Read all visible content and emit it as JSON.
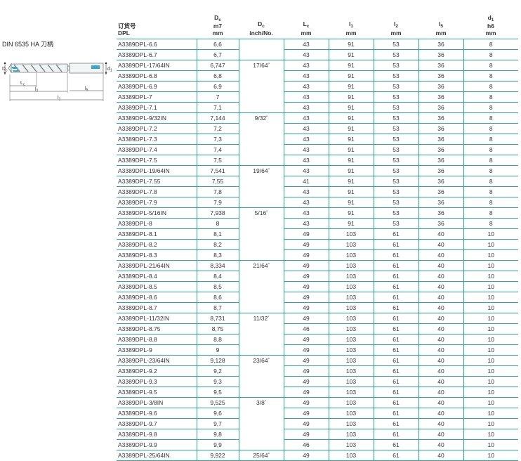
{
  "left_panel": {
    "standard_label": "DIN 6535 HA 刀柄",
    "diagram_labels": {
      "dc": "D",
      "dc_sub": "c",
      "d1": "d",
      "d1_sub": "1",
      "lc": "L",
      "lc_sub": "c",
      "l2": "l",
      "l2_sub": "2",
      "l5": "l",
      "l5_sub": "5",
      "l1": "l",
      "l1_sub": "1"
    }
  },
  "table": {
    "headers": {
      "order_line1": "订货号",
      "order_line2": "DPL",
      "dc_main": "D",
      "dc_sub": "c",
      "dc_line2": "m7",
      "dc_line3": "mm",
      "inch_main": "D",
      "inch_sub": "c",
      "inch_line2": "inch/No.",
      "lc_main": "L",
      "lc_sub": "c",
      "lc_line2": "mm",
      "l1_main": "l",
      "l1_sub": "1",
      "l1_line2": "mm",
      "l2_main": "l",
      "l2_sub": "2",
      "l2_line2": "mm",
      "l5_main": "l",
      "l5_sub": "5",
      "l5_line2": "mm",
      "d1_main": "d",
      "d1_sub": "1",
      "d1_line2": "h6",
      "d1_line3": "mm"
    },
    "rows": [
      {
        "order": "A3389DPL-6.6",
        "dc": "6,6",
        "inch": "",
        "lc": "43",
        "l1": "91",
        "l2": "53",
        "l5": "36",
        "d1": "8"
      },
      {
        "order": "A3389DPL-6.7",
        "dc": "6,7",
        "inch": "",
        "lc": "43",
        "l1": "91",
        "l2": "53",
        "l5": "36",
        "d1": "8"
      },
      {
        "order": "A3389DPL-17/64IN",
        "dc": "6,747",
        "inch": "17/64",
        "lc": "43",
        "l1": "91",
        "l2": "53",
        "l5": "36",
        "d1": "8"
      },
      {
        "order": "A3389DPL-6.8",
        "dc": "6,8",
        "inch": "",
        "lc": "43",
        "l1": "91",
        "l2": "53",
        "l5": "36",
        "d1": "8"
      },
      {
        "order": "A3389DPL-6.9",
        "dc": "6,9",
        "inch": "",
        "lc": "43",
        "l1": "91",
        "l2": "53",
        "l5": "36",
        "d1": "8"
      },
      {
        "order": "A3389DPL-7",
        "dc": "7",
        "inch": "",
        "lc": "43",
        "l1": "91",
        "l2": "53",
        "l5": "36",
        "d1": "8"
      },
      {
        "order": "A3389DPL-7.1",
        "dc": "7,1",
        "inch": "",
        "lc": "43",
        "l1": "91",
        "l2": "53",
        "l5": "36",
        "d1": "8"
      },
      {
        "order": "A3389DPL-9/32IN",
        "dc": "7,144",
        "inch": "9/32",
        "lc": "43",
        "l1": "91",
        "l2": "53",
        "l5": "36",
        "d1": "8"
      },
      {
        "order": "A3389DPL-7.2",
        "dc": "7,2",
        "inch": "",
        "lc": "43",
        "l1": "91",
        "l2": "53",
        "l5": "36",
        "d1": "8"
      },
      {
        "order": "A3389DPL-7.3",
        "dc": "7,3",
        "inch": "",
        "lc": "43",
        "l1": "91",
        "l2": "53",
        "l5": "36",
        "d1": "8"
      },
      {
        "order": "A3389DPL-7.4",
        "dc": "7,4",
        "inch": "",
        "lc": "43",
        "l1": "91",
        "l2": "53",
        "l5": "36",
        "d1": "8"
      },
      {
        "order": "A3389DPL-7.5",
        "dc": "7,5",
        "inch": "",
        "lc": "43",
        "l1": "91",
        "l2": "53",
        "l5": "36",
        "d1": "8"
      },
      {
        "order": "A3389DPL-19/64IN",
        "dc": "7,541",
        "inch": "19/64",
        "lc": "43",
        "l1": "91",
        "l2": "53",
        "l5": "36",
        "d1": "8"
      },
      {
        "order": "A3389DPL-7.55",
        "dc": "7,55",
        "inch": "",
        "lc": "41",
        "l1": "91",
        "l2": "53",
        "l5": "36",
        "d1": "8"
      },
      {
        "order": "A3389DPL-7.8",
        "dc": "7,8",
        "inch": "",
        "lc": "43",
        "l1": "91",
        "l2": "53",
        "l5": "36",
        "d1": "8"
      },
      {
        "order": "A3389DPL-7.9",
        "dc": "7,9",
        "inch": "",
        "lc": "43",
        "l1": "91",
        "l2": "53",
        "l5": "36",
        "d1": "8"
      },
      {
        "order": "A3389DPL-5/16IN",
        "dc": "7,938",
        "inch": "5/16",
        "lc": "43",
        "l1": "91",
        "l2": "53",
        "l5": "36",
        "d1": "8"
      },
      {
        "order": "A3389DPL-8",
        "dc": "8",
        "inch": "",
        "lc": "43",
        "l1": "91",
        "l2": "53",
        "l5": "36",
        "d1": "8"
      },
      {
        "order": "A3389DPL-8.1",
        "dc": "8,1",
        "inch": "",
        "lc": "49",
        "l1": "103",
        "l2": "61",
        "l5": "40",
        "d1": "10"
      },
      {
        "order": "A3389DPL-8.2",
        "dc": "8,2",
        "inch": "",
        "lc": "49",
        "l1": "103",
        "l2": "61",
        "l5": "40",
        "d1": "10"
      },
      {
        "order": "A3389DPL-8.3",
        "dc": "8,3",
        "inch": "",
        "lc": "49",
        "l1": "103",
        "l2": "61",
        "l5": "40",
        "d1": "10"
      },
      {
        "order": "A3389DPL-21/64IN",
        "dc": "8,334",
        "inch": "21/64",
        "lc": "49",
        "l1": "103",
        "l2": "61",
        "l5": "40",
        "d1": "10"
      },
      {
        "order": "A3389DPL-8.4",
        "dc": "8,4",
        "inch": "",
        "lc": "49",
        "l1": "103",
        "l2": "61",
        "l5": "40",
        "d1": "10"
      },
      {
        "order": "A3389DPL-8.5",
        "dc": "8,5",
        "inch": "",
        "lc": "49",
        "l1": "103",
        "l2": "61",
        "l5": "40",
        "d1": "10"
      },
      {
        "order": "A3389DPL-8.6",
        "dc": "8,6",
        "inch": "",
        "lc": "49",
        "l1": "103",
        "l2": "61",
        "l5": "40",
        "d1": "10"
      },
      {
        "order": "A3389DPL-8.7",
        "dc": "8,7",
        "inch": "",
        "lc": "49",
        "l1": "103",
        "l2": "61",
        "l5": "40",
        "d1": "10"
      },
      {
        "order": "A3389DPL-11/32IN",
        "dc": "8,731",
        "inch": "11/32",
        "lc": "49",
        "l1": "103",
        "l2": "61",
        "l5": "40",
        "d1": "10"
      },
      {
        "order": "A3389DPL-8.75",
        "dc": "8,75",
        "inch": "",
        "lc": "46",
        "l1": "103",
        "l2": "61",
        "l5": "40",
        "d1": "10"
      },
      {
        "order": "A3389DPL-8.8",
        "dc": "8,8",
        "inch": "",
        "lc": "49",
        "l1": "103",
        "l2": "61",
        "l5": "40",
        "d1": "10"
      },
      {
        "order": "A3389DPL-9",
        "dc": "9",
        "inch": "",
        "lc": "49",
        "l1": "103",
        "l2": "61",
        "l5": "40",
        "d1": "10"
      },
      {
        "order": "A3389DPL-23/64IN",
        "dc": "9,128",
        "inch": "23/64",
        "lc": "49",
        "l1": "103",
        "l2": "61",
        "l5": "40",
        "d1": "10"
      },
      {
        "order": "A3389DPL-9.2",
        "dc": "9,2",
        "inch": "",
        "lc": "49",
        "l1": "103",
        "l2": "61",
        "l5": "40",
        "d1": "10"
      },
      {
        "order": "A3389DPL-9.3",
        "dc": "9,3",
        "inch": "",
        "lc": "49",
        "l1": "103",
        "l2": "61",
        "l5": "40",
        "d1": "10"
      },
      {
        "order": "A3389DPL-9.5",
        "dc": "9,5",
        "inch": "",
        "lc": "49",
        "l1": "103",
        "l2": "61",
        "l5": "40",
        "d1": "10"
      },
      {
        "order": "A3389DPL-3/8IN",
        "dc": "9,525",
        "inch": "3/8",
        "lc": "49",
        "l1": "103",
        "l2": "61",
        "l5": "40",
        "d1": "10"
      },
      {
        "order": "A3389DPL-9.6",
        "dc": "9,6",
        "inch": "",
        "lc": "49",
        "l1": "103",
        "l2": "61",
        "l5": "40",
        "d1": "10"
      },
      {
        "order": "A3389DPL-9.7",
        "dc": "9,7",
        "inch": "",
        "lc": "49",
        "l1": "103",
        "l2": "61",
        "l5": "40",
        "d1": "10"
      },
      {
        "order": "A3389DPL-9.8",
        "dc": "9,8",
        "inch": "",
        "lc": "49",
        "l1": "103",
        "l2": "61",
        "l5": "40",
        "d1": "10"
      },
      {
        "order": "A3389DPL-9.9",
        "dc": "9,9",
        "inch": "",
        "lc": "46",
        "l1": "103",
        "l2": "61",
        "l5": "40",
        "d1": "10"
      },
      {
        "order": "A3389DPL-25/64IN",
        "dc": "9,922",
        "inch": "25/64",
        "lc": "49",
        "l1": "103",
        "l2": "61",
        "l5": "40",
        "d1": "10"
      }
    ]
  },
  "colors": {
    "rule": "#2ba99a",
    "text": "#333333",
    "flute_accent": "#3aa6c9"
  }
}
